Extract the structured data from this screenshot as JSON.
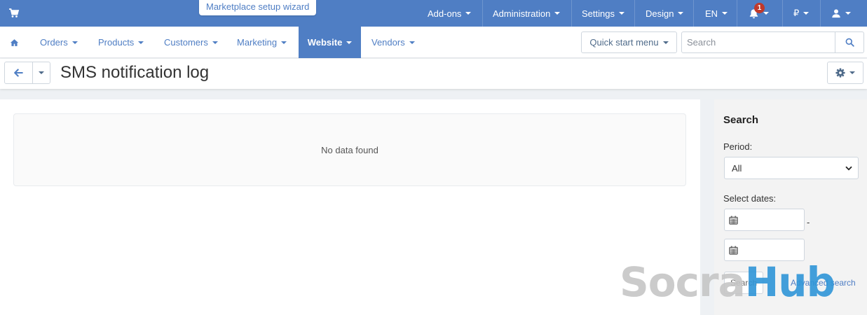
{
  "topbar": {
    "wizard_label": "Marketplace setup wizard",
    "menu": [
      {
        "label": "Add-ons"
      },
      {
        "label": "Administration"
      },
      {
        "label": "Settings"
      },
      {
        "label": "Design"
      },
      {
        "label": "EN"
      }
    ],
    "notification_count": "1",
    "currency": "₽"
  },
  "navbar": {
    "items": [
      {
        "label": "Orders"
      },
      {
        "label": "Products"
      },
      {
        "label": "Customers"
      },
      {
        "label": "Marketing"
      },
      {
        "label": "Website"
      },
      {
        "label": "Vendors"
      }
    ],
    "active_item": "Website",
    "quick_start_label": "Quick start menu",
    "search_placeholder": "Search"
  },
  "page": {
    "title": "SMS notification log",
    "empty_message": "No data found"
  },
  "sidebar": {
    "heading": "Search",
    "period_label": "Period:",
    "period_value": "All",
    "dates_label": "Select dates:",
    "date_separator": "-",
    "search_button": "Search",
    "advanced_search": "Advanced search"
  },
  "watermark": {
    "part1": "Socra",
    "part2": "Hub"
  },
  "colors": {
    "accent": "#4f7ec4",
    "badge": "#c0392b",
    "watermark_gray": "#c6c6c6",
    "watermark_blue": "#2f95d8"
  }
}
